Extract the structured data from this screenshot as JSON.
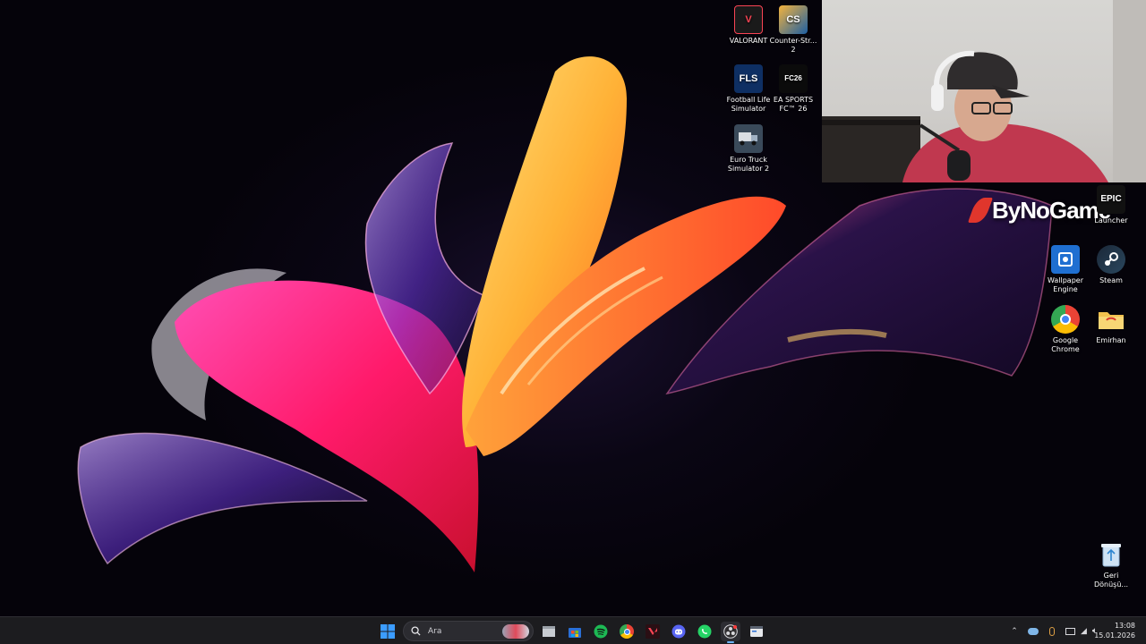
{
  "desktop": {
    "icons": [
      {
        "label": "VALORANT",
        "icon": "valorant-icon",
        "color": "#fa4454"
      },
      {
        "label": "Counter-Str... 2",
        "icon": "counter-strike-icon",
        "color": "#de9b35"
      },
      {
        "label": "Football Life Simulator",
        "icon": "football-life-icon",
        "color": "#1d4f91",
        "badge": "FLS"
      },
      {
        "label": "EA SPORTS FC™ 26",
        "icon": "ea-fc-icon",
        "color": "#0b0b0b",
        "badge": "FC26"
      },
      {
        "label": "Euro Truck Simulator 2",
        "icon": "euro-truck-icon",
        "color": "#2f3b48"
      },
      {
        "label": "Launcher",
        "icon": "epic-games-icon",
        "color": "#111111",
        "badge": "EPIC"
      },
      {
        "label": "Wallpaper Engine",
        "icon": "wallpaper-engine-icon",
        "color": "#1f6fd1"
      },
      {
        "label": "Steam",
        "icon": "steam-icon",
        "color": "#1b2838"
      },
      {
        "label": "Google Chrome",
        "icon": "chrome-icon",
        "color": "#4285f4"
      },
      {
        "label": "Emirhan",
        "icon": "folder-icon",
        "color": "#f2c14e"
      },
      {
        "label": "Geri Dönüşü...",
        "icon": "recycle-bin-icon",
        "color": "#a8c8e8"
      }
    ]
  },
  "overlay": {
    "brand": "ByNoGame",
    "epic_badge": "EPIC"
  },
  "taskbar": {
    "search_placeholder": "Ara",
    "apps": [
      {
        "name": "file-explorer-icon"
      },
      {
        "name": "microsoft-store-icon"
      },
      {
        "name": "spotify-icon"
      },
      {
        "name": "chrome-icon"
      },
      {
        "name": "valorant-icon"
      },
      {
        "name": "discord-icon"
      },
      {
        "name": "whatsapp-icon"
      },
      {
        "name": "obs-icon"
      },
      {
        "name": "terminal-icon"
      }
    ],
    "time": "13:08",
    "date": "15.01.2026"
  },
  "colors": {
    "taskbar_bg": "#1c1c1f",
    "windows_blue": "#3b9cff",
    "spotify_green": "#1db954",
    "discord_blurple": "#5865f2",
    "whatsapp_green": "#25d366"
  }
}
